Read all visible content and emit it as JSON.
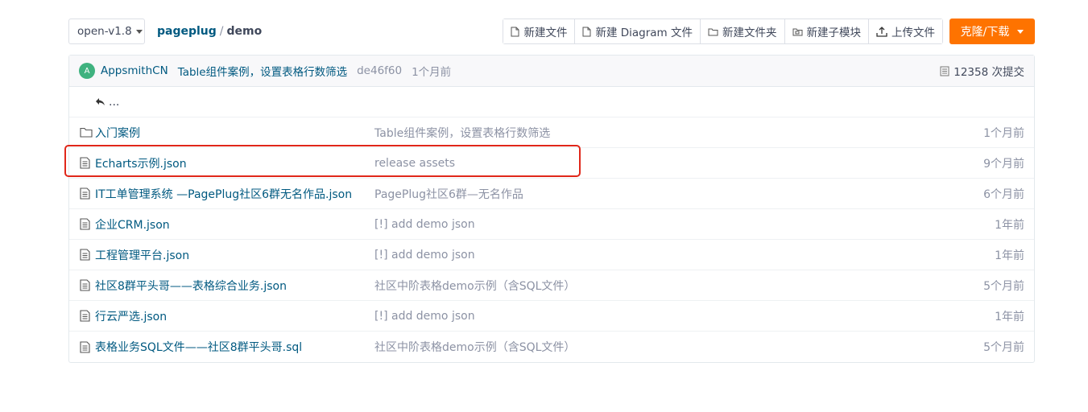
{
  "branch": {
    "label": "open-v1.8"
  },
  "breadcrumb": {
    "repo": "pageplug",
    "separator": "/",
    "current": "demo"
  },
  "actions": [
    {
      "label": "新建文件",
      "icon": "new-file-icon"
    },
    {
      "label": "新建 Diagram 文件",
      "icon": "new-file-icon"
    },
    {
      "label": "新建文件夹",
      "icon": "new-folder-icon"
    },
    {
      "label": "新建子模块",
      "icon": "submodule-icon"
    },
    {
      "label": "上传文件",
      "icon": "upload-icon"
    }
  ],
  "clone": {
    "label": "克隆/下载"
  },
  "commit": {
    "avatar_letter": "A",
    "author": "AppsmithCN",
    "message": "Table组件案例，设置表格行数筛选",
    "sha": "de46f60",
    "time": "1个月前",
    "count_label": "12358 次提交"
  },
  "parent": {
    "label": "..."
  },
  "files": [
    {
      "type": "folder",
      "name": "入门案例",
      "message": "Table组件案例，设置表格行数筛选",
      "time": "1个月前"
    },
    {
      "type": "file",
      "name": "Echarts示例.json",
      "message": "release assets",
      "time": "9个月前"
    },
    {
      "type": "file",
      "name": "IT工单管理系统 —PagePlug社区6群无名作品.json",
      "message": "PagePlug社区6群—无名作品",
      "time": "6个月前"
    },
    {
      "type": "file",
      "name": "企业CRM.json",
      "message": "[!] add demo json",
      "time": "1年前"
    },
    {
      "type": "file",
      "name": "工程管理平台.json",
      "message": "[!] add demo json",
      "time": "1年前"
    },
    {
      "type": "file",
      "name": "社区8群平头哥——表格综合业务.json",
      "message": "社区中阶表格demo示例（含SQL文件）",
      "time": "5个月前"
    },
    {
      "type": "file",
      "name": "行云严选.json",
      "message": "[!] add demo json",
      "time": "1年前"
    },
    {
      "type": "file",
      "name": "表格业务SQL文件——社区8群平头哥.sql",
      "message": "社区中阶表格demo示例（含SQL文件）",
      "time": "5个月前"
    }
  ],
  "colors": {
    "link": "#005980",
    "muted": "#8c92a4",
    "accent": "#fe7300",
    "highlight": "#e0271a",
    "avatar": "#3fb27f"
  }
}
